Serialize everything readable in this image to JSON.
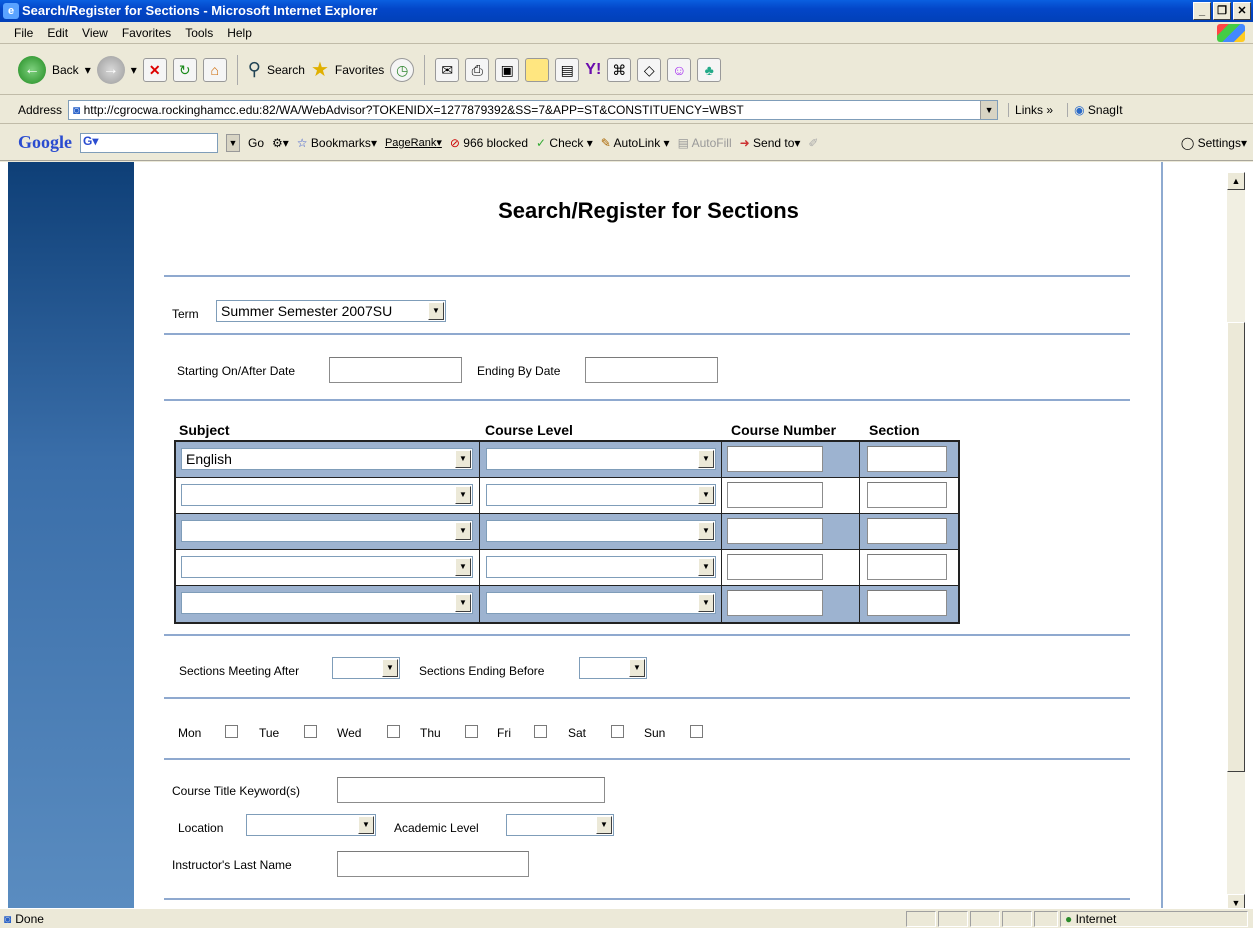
{
  "window": {
    "title": "Search/Register for Sections - Microsoft Internet Explorer"
  },
  "menu": [
    "File",
    "Edit",
    "View",
    "Favorites",
    "Tools",
    "Help"
  ],
  "toolbar": {
    "back": "Back",
    "search": "Search",
    "favorites": "Favorites"
  },
  "address": {
    "label": "Address",
    "url": "http://cgrocwa.rockinghamcc.edu:82/WA/WebAdvisor?TOKENIDX=1277879392&SS=7&APP=ST&CONSTITUENCY=WBST",
    "links": "Links",
    "snagit": "SnagIt"
  },
  "googlebar": {
    "logo": "Google",
    "go": "Go",
    "bookmarks": "Bookmarks",
    "pagerank": "PageRank",
    "blocked": "966 blocked",
    "check": "Check",
    "autolink": "AutoLink",
    "autofill": "AutoFill",
    "sendto": "Send to",
    "settings": "Settings"
  },
  "page": {
    "title": "Search/Register for Sections",
    "term_label": "Term",
    "term_value": "Summer Semester 2007SU",
    "starting_label": "Starting On/After Date",
    "ending_label": "Ending By Date",
    "headers": {
      "subject": "Subject",
      "course_level": "Course Level",
      "course_number": "Course Number",
      "section": "Section"
    },
    "rows": [
      {
        "subject": "English"
      },
      {
        "subject": ""
      },
      {
        "subject": ""
      },
      {
        "subject": ""
      },
      {
        "subject": ""
      }
    ],
    "meeting_after_label": "Sections Meeting After",
    "ending_before_label": "Sections Ending Before",
    "days": [
      "Mon",
      "Tue",
      "Wed",
      "Thu",
      "Fri",
      "Sat",
      "Sun"
    ],
    "keyword_label": "Course Title Keyword(s)",
    "location_label": "Location",
    "academic_level_label": "Academic Level",
    "instructor_label": "Instructor's Last Name"
  },
  "status": {
    "text": "Done",
    "zone": "Internet"
  }
}
